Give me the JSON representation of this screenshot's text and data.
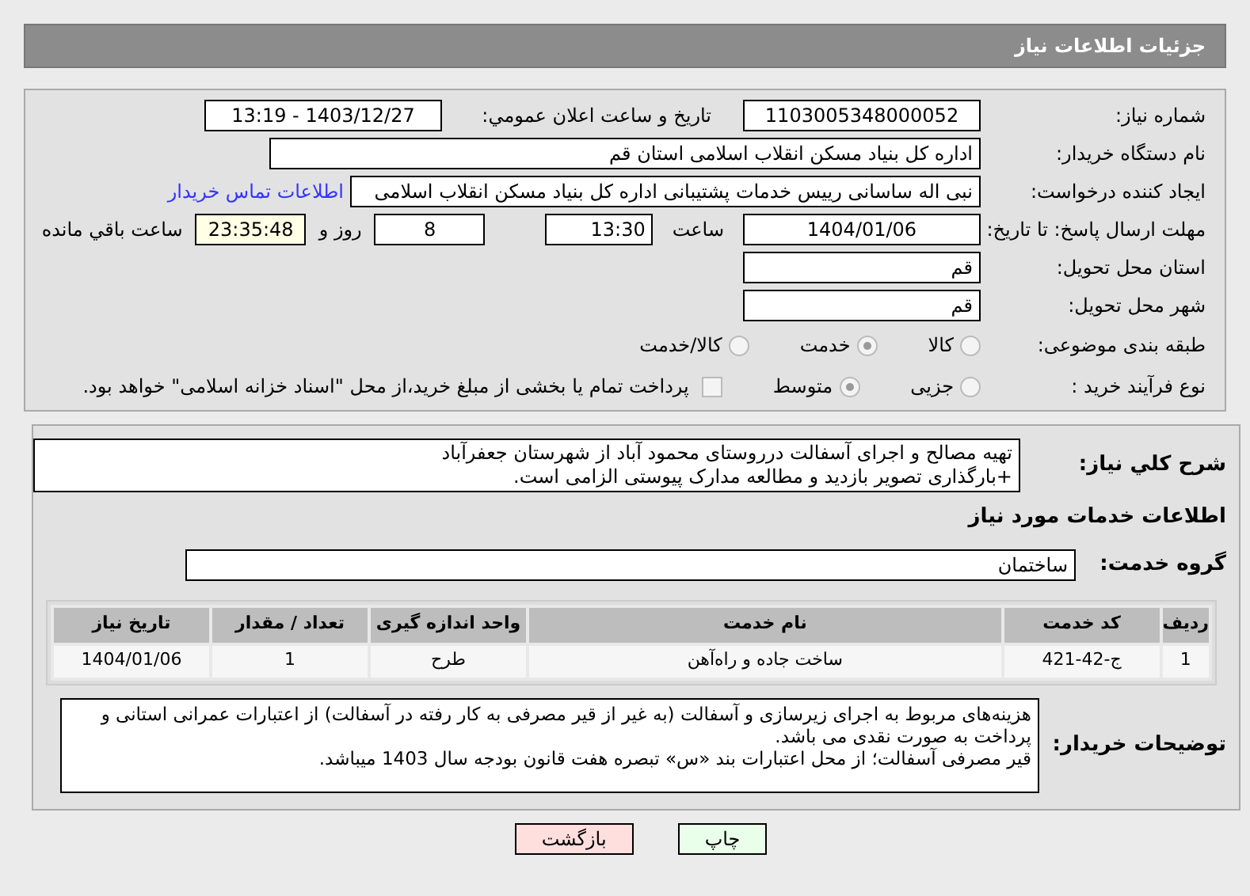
{
  "header": {
    "title": "جزئیات اطلاعات نیاز"
  },
  "need_number": {
    "label": "شماره نیاز:",
    "value": "1103005348000052"
  },
  "announce": {
    "label": "تاریخ و ساعت اعلان عمومي:",
    "value": "1403/12/27 - 13:19"
  },
  "buyer": {
    "label": "نام دستگاه خریدار:",
    "value": "اداره کل بنیاد مسکن انقلاب اسلامی استان قم"
  },
  "creator": {
    "label": "ایجاد کننده درخواست:",
    "value": "نبی اله ساسانی رییس خدمات پشتیبانی اداره کل بنیاد مسکن انقلاب اسلامی",
    "link": "اطلاعات تماس خریدار"
  },
  "deadline": {
    "label": "مهلت ارسال پاسخ: تا تاریخ:",
    "date": "1404/01/06",
    "time_label": "ساعت",
    "time": "13:30",
    "days": "8",
    "days_label": "روز و",
    "remaining": "23:35:48",
    "remaining_label": "ساعت باقي مانده"
  },
  "province": {
    "label": "استان محل تحویل:",
    "value": "قم"
  },
  "city": {
    "label": "شهر محل تحویل:",
    "value": "قم"
  },
  "category": {
    "label": "طبقه بندی موضوعی:",
    "options": [
      {
        "label": "کالا",
        "selected": false
      },
      {
        "label": "خدمت",
        "selected": true
      },
      {
        "label": "کالا/خدمت",
        "selected": false
      }
    ]
  },
  "process": {
    "label": "نوع فرآیند خرید :",
    "options": [
      {
        "label": "جزیی",
        "selected": false
      },
      {
        "label": "متوسط",
        "selected": true
      }
    ],
    "treasury": {
      "label": "پرداخت تمام یا بخشی از مبلغ خرید،از محل \"اسناد خزانه اسلامی\" خواهد بود.",
      "checked": false
    }
  },
  "description": {
    "label": "شرح کلي نیاز:",
    "lines": [
      "تهیه مصالح و اجرای  آسفالت درروستای محمود آباد از شهرستان جعفرآباد",
      "+بارگذاری تصویر بازدید و مطالعه مدارک پیوستی الزامی است."
    ]
  },
  "services_heading": "اطلاعات خدمات مورد نیاز",
  "service_group": {
    "label": "گروه خدمت:",
    "value": "ساختمان"
  },
  "table": {
    "columns": [
      "ردیف",
      "کد خدمت",
      "نام خدمت",
      "واحد اندازه گیری",
      "تعداد / مقدار",
      "تاریخ نیاز"
    ],
    "rows": [
      [
        "1",
        "ج-42-421",
        "ساخت جاده و راه‌آهن",
        "طرح",
        "1",
        "1404/01/06"
      ]
    ]
  },
  "buyer_notes": {
    "label": "توضیحات خریدار:",
    "lines": [
      "هزینه‌های مربوط به اجرای زیرسازی و آسفالت (به غیر از قیر مصرفی به کار رفته در آسفالت) از اعتبارات عمرانی استانی  و پرداخت به صورت نقدی می باشد.",
      "قیر مصرفی آسفالت؛  از محل اعتبارات  بند «س» تبصره هفت قانون بودجه سال 1403 میباشد."
    ]
  },
  "buttons": [
    {
      "label": "چاپ",
      "kind": "print"
    },
    {
      "label": "بازگشت",
      "kind": "back"
    }
  ]
}
